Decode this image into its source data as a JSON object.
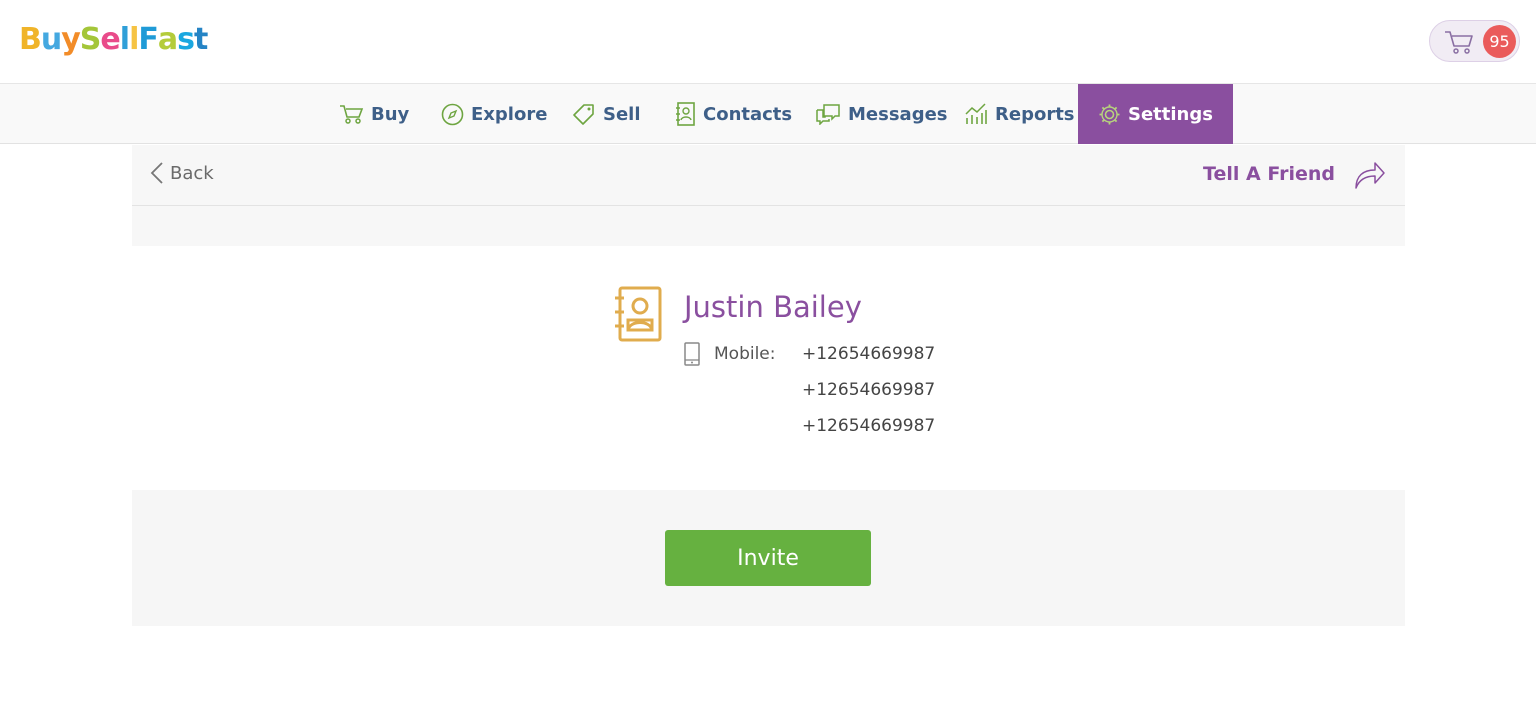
{
  "brand": {
    "logo_text": "BuySellFast"
  },
  "cart": {
    "count": "95"
  },
  "nav": {
    "items": [
      {
        "label": "Buy"
      },
      {
        "label": "Explore"
      },
      {
        "label": "Sell"
      },
      {
        "label": "Contacts"
      },
      {
        "label": "Messages"
      },
      {
        "label": "Reports"
      },
      {
        "label": "Settings"
      }
    ],
    "active": "Settings"
  },
  "toolbar": {
    "back_label": "Back",
    "tell_label": "Tell A Friend"
  },
  "contact": {
    "name": "Justin Bailey",
    "mobile_label": "Mobile:",
    "numbers": [
      "+12654669987",
      "+12654669987",
      "+12654669987"
    ]
  },
  "actions": {
    "invite_label": "Invite"
  },
  "colors": {
    "accent": "#8a4f9f",
    "nav_text": "#3e5f88",
    "success": "#66b140",
    "badge": "#ea5b5b",
    "contact_icon": "#e0ac4e"
  }
}
